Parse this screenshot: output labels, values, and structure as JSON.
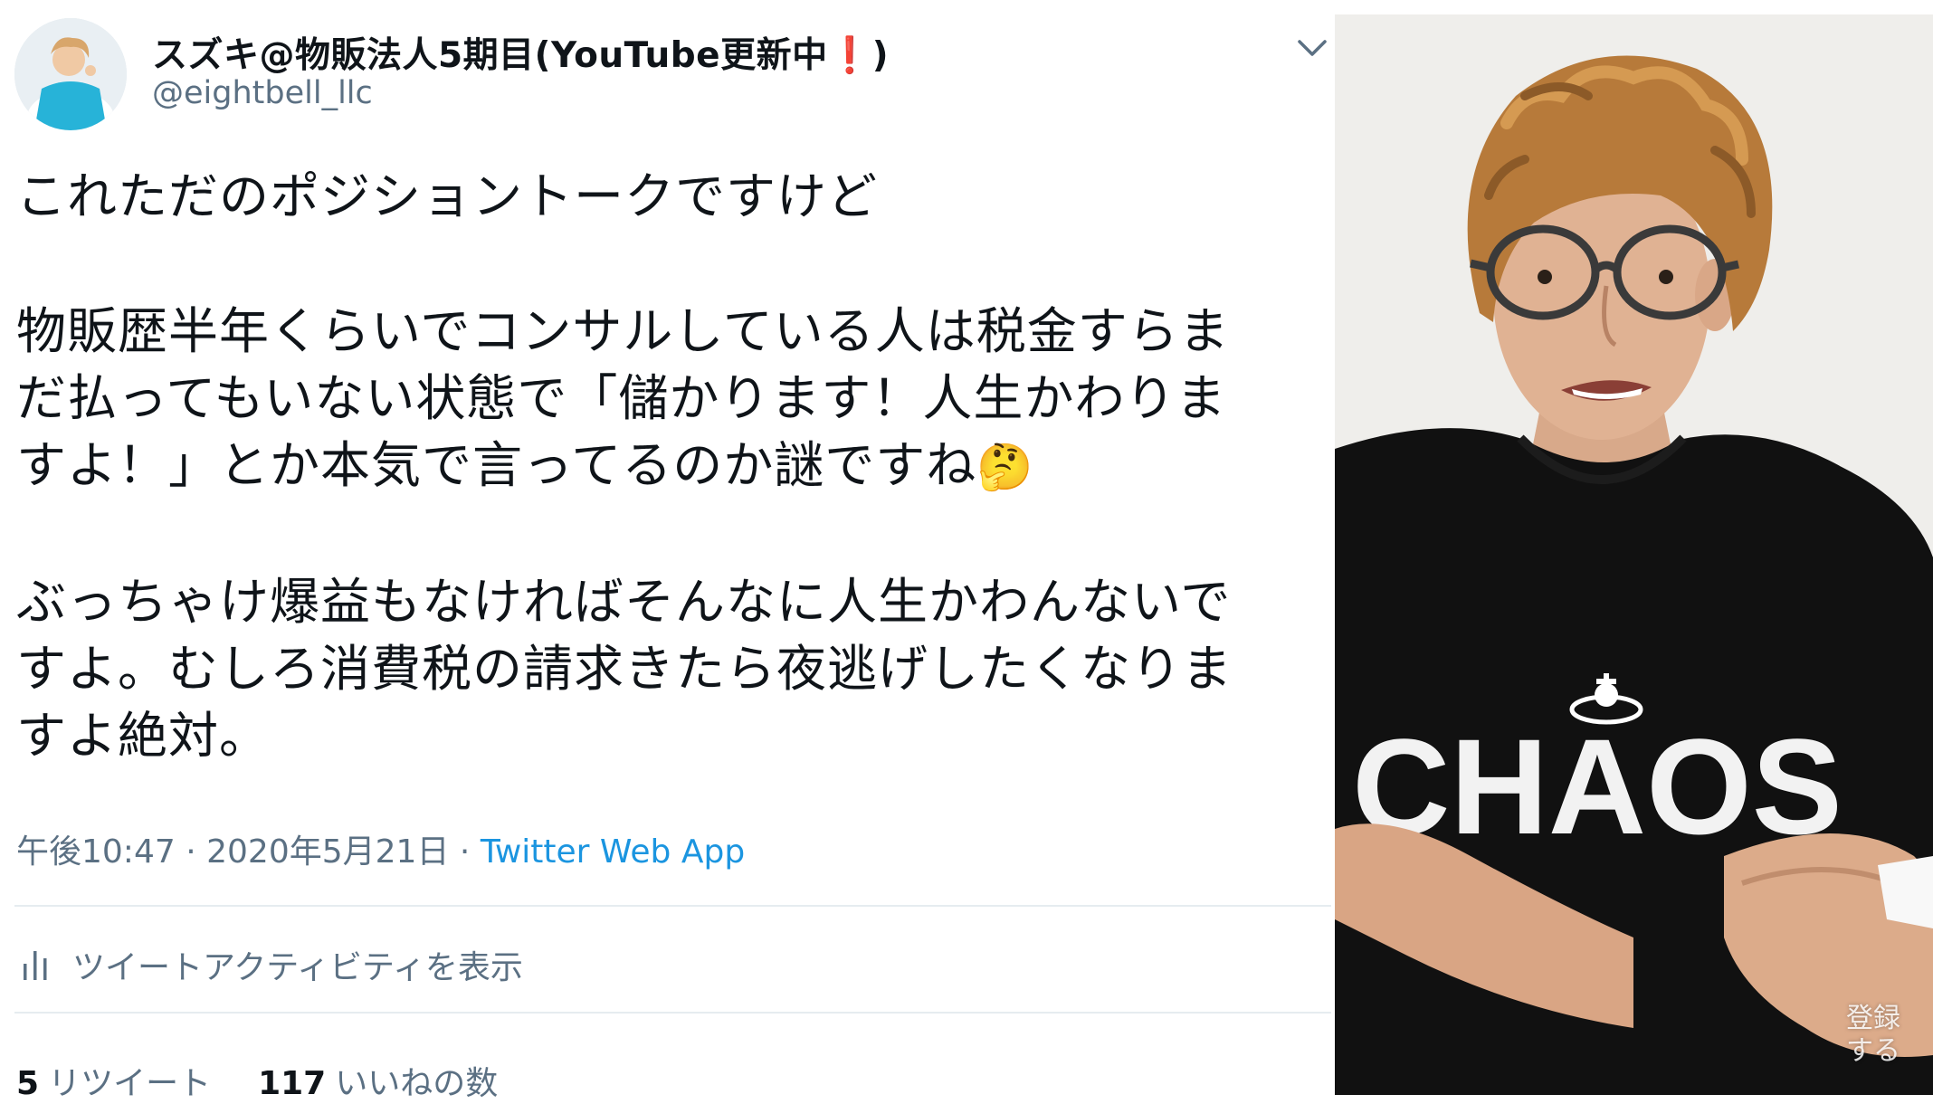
{
  "tweet": {
    "display_name": "スズキ@物販法人5期目(YouTube更新中❗)",
    "handle": "@eightbell_llc",
    "text_lines": {
      "l1": "これただのポジショントークですけど",
      "l2": "物販歴半年くらいでコンサルしている人は税金すらま",
      "l3": "だ払ってもいない状態で「儲かります！人生かわりま",
      "l4": "すよ！」とか本気で言ってるのか謎ですね",
      "emoji": "🤔",
      "l5": "ぶっちゃけ爆益もなければそんなに人生かわんないで",
      "l6": "すよ。むしろ消費税の請求きたら夜逃げしたくなりま",
      "l7": "すよ絶対。"
    },
    "time": "午後10:47",
    "dot": "·",
    "date": "2020年5月21日",
    "source": "Twitter Web App",
    "activity_label": "ツイートアクティビティを表示",
    "retweets_count": "5",
    "retweets_label": "リツイート",
    "likes_count": "117",
    "likes_label": "いいねの数",
    "icons": {
      "more": "chevron-down-icon",
      "activity": "bar-chart-icon"
    }
  },
  "video": {
    "shirt_text": "CHAOS",
    "subscribe_label": "登録する"
  },
  "colors": {
    "text": "#0f1419",
    "muted": "#5b7083",
    "link": "#1b95e0",
    "divider": "#e6ecf0",
    "shirt": "#111111"
  }
}
